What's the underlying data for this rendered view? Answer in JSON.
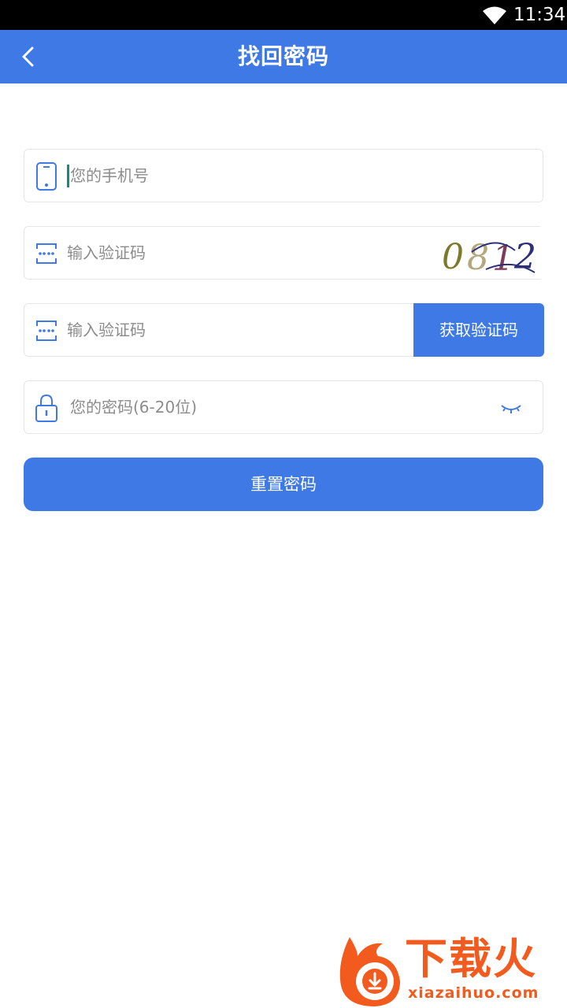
{
  "status_bar": {
    "time": "11:34"
  },
  "header": {
    "title": "找回密码"
  },
  "form": {
    "phone_placeholder": "您的手机号",
    "captcha_placeholder": "输入验证码",
    "sms_code_placeholder": "输入验证码",
    "sms_button_label": "获取验证码",
    "password_placeholder": "您的密码(6-20位)",
    "submit_label": "重置密码"
  },
  "captcha_image": {
    "text": "0812"
  },
  "watermark": {
    "title": "下载火",
    "subtitle": "xiazaihuo.com"
  },
  "colors": {
    "brand": "#3e79e5",
    "icon": "#3e79e5",
    "watermark": "#f25a1e"
  }
}
